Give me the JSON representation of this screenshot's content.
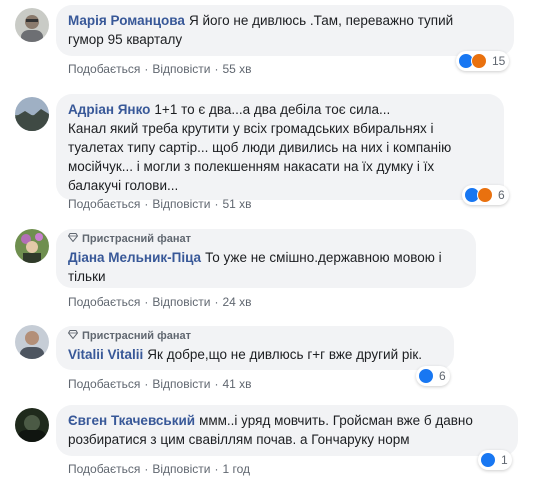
{
  "badge_label": "Пристрасний фанат",
  "actions": {
    "like": "Подобається",
    "reply": "Відповісти"
  },
  "comments": [
    {
      "author": "Марія Романцова",
      "lines": [
        "Я його не дивлюсь .Там, переважно тупий",
        "гумор 95 кварталу"
      ],
      "time": "55 хв",
      "reaction_count": "15",
      "reactions": [
        "like",
        "angry"
      ]
    },
    {
      "author": "Адріан Янко",
      "lines": [
        "1+1 то є два...а два дебіла тоє сила...",
        "Канал який треба крутити у всіх громадських вбиральнях і",
        "туалетах типу сартір... щоб люди дивились на них і компанію",
        "мосійчук... і могли з полекшенням накасати на їх думку і їх",
        "балакучі голови..."
      ],
      "time": "51 хв",
      "reaction_count": "6",
      "reactions": [
        "like",
        "angry"
      ]
    },
    {
      "author": "Діана Мельник-Піца",
      "badge": true,
      "lines": [
        "То уже не смішно.державною мовою і",
        "тільки"
      ],
      "time": "24 хв"
    },
    {
      "author": "Vitalii Vitalii",
      "badge": true,
      "lines": [
        "Як добре,що не дивлюсь г+г вже другий рік."
      ],
      "time": "41 хв",
      "reaction_count": "6",
      "reactions": [
        "like"
      ]
    },
    {
      "author": "Євген Ткачевський",
      "lines": [
        "ммм..і уряд мовчить. Гройсман вже б давно",
        "розбиратися з цим свавіллям почав. а Гончаруку норм"
      ],
      "time": "1 год",
      "reaction_count": "1",
      "reactions": [
        "like"
      ]
    }
  ],
  "colors": {
    "author": "#385898",
    "bubble": "#f2f3f5",
    "like": "#1877f2",
    "angry": "#e9710f"
  }
}
